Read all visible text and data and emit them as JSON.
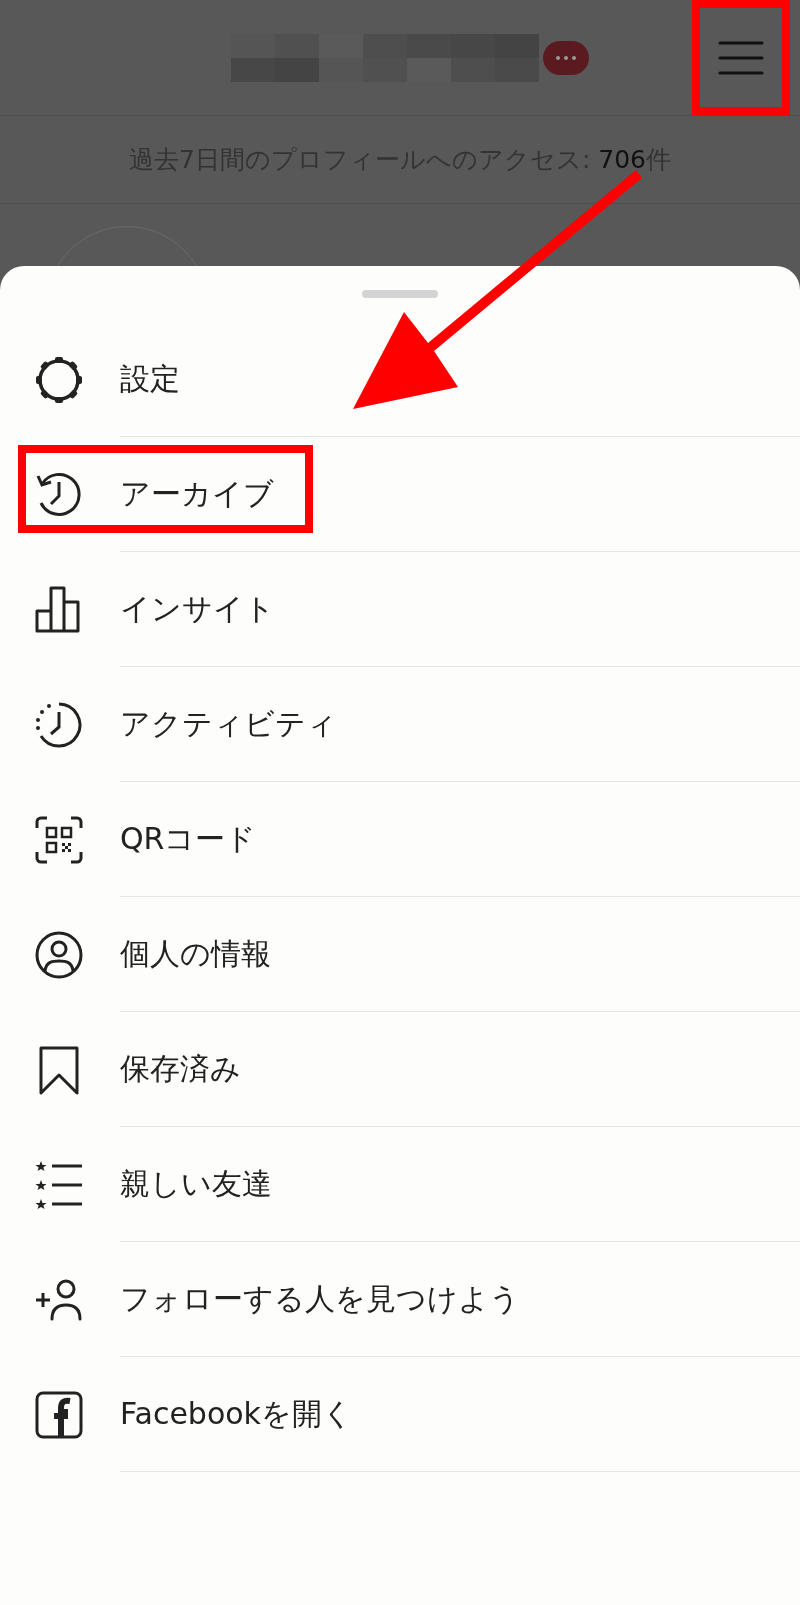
{
  "header": {
    "menu_button": {
      "highlighted": true
    }
  },
  "profile_visits": {
    "label": "過去7日間のプロフィールへのアクセス: ",
    "count": "706",
    "unit": "件"
  },
  "menu": {
    "items": [
      {
        "label": "設定",
        "kind": "gear",
        "highlighted": false
      },
      {
        "label": "アーカイブ",
        "kind": "archive",
        "highlighted": true
      },
      {
        "label": "インサイト",
        "kind": "bars",
        "highlighted": false
      },
      {
        "label": "アクティビティ",
        "kind": "activity",
        "highlighted": false
      },
      {
        "label": "QRコード",
        "kind": "qr",
        "highlighted": false
      },
      {
        "label": "個人の情報",
        "kind": "person",
        "highlighted": false
      },
      {
        "label": "保存済み",
        "kind": "bookmark",
        "highlighted": false
      },
      {
        "label": "親しい友達",
        "kind": "stars",
        "highlighted": false
      },
      {
        "label": "フォローする人を見つけよう",
        "kind": "addperson",
        "highlighted": false
      },
      {
        "label": "Facebookを開く",
        "kind": "facebook",
        "highlighted": false
      }
    ]
  }
}
